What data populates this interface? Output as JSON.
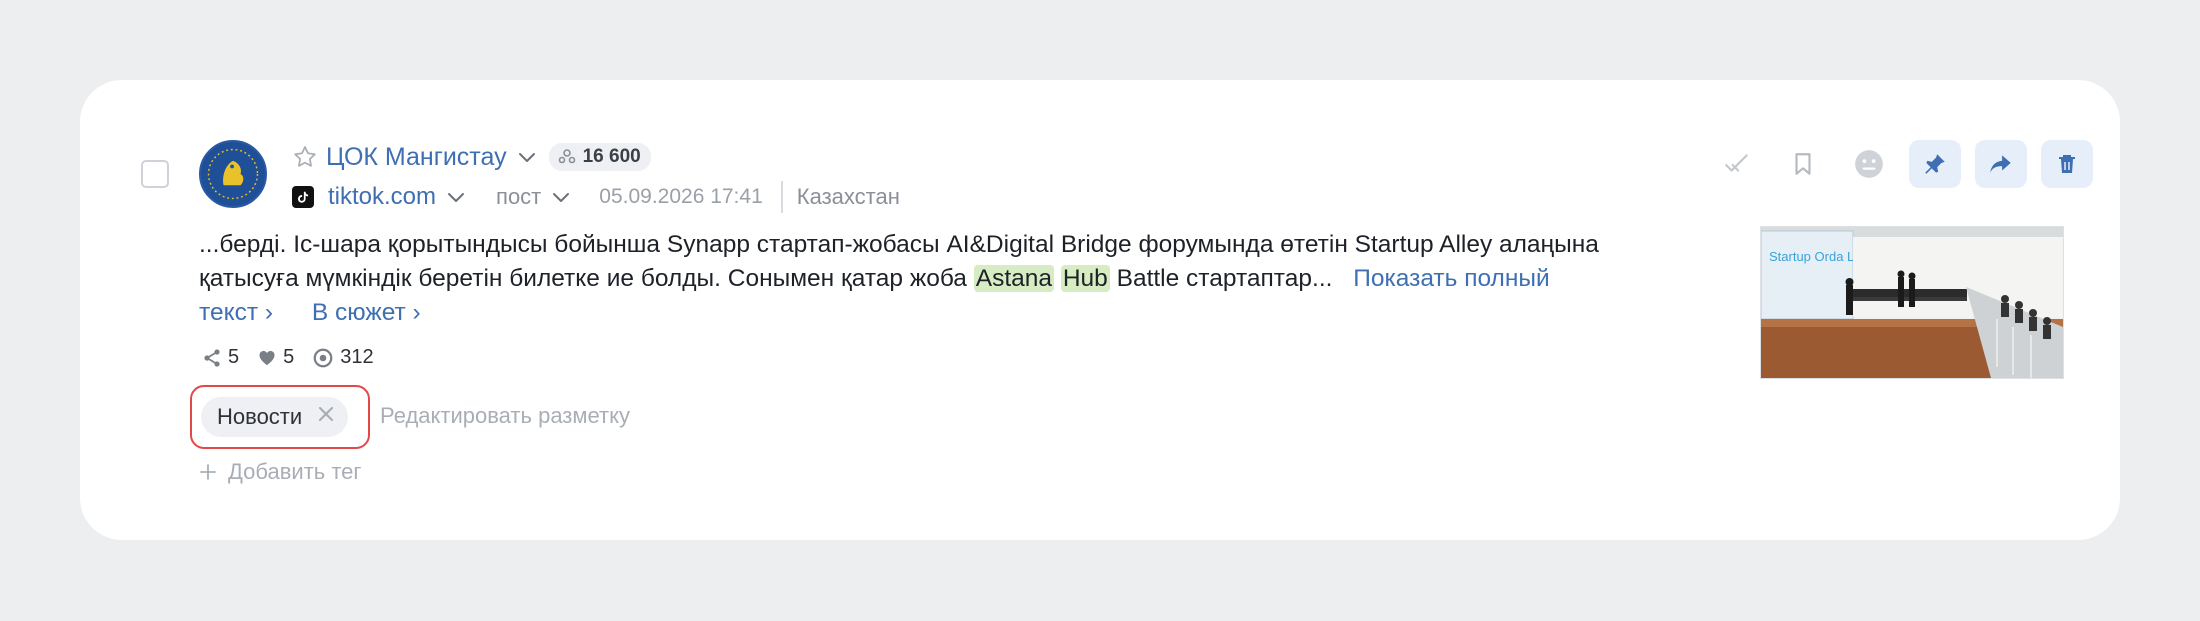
{
  "post": {
    "source_name": "ЦОК Мангистау",
    "audience_count": "16 600",
    "domain": "tiktok.com",
    "type": "пост",
    "datetime": "05.09.2026 17:41",
    "country": "Казахстан",
    "text_parts": {
      "p1": "...берді. Іс-шара қорытындысы бойынша Synapp стартап-жобасы AI&Digital Bridge форумында өтетін Startup Alley алаңына қатысуға мүмкіндік беретін билетке ие болды. Сонымен қатар жоба ",
      "hl1": "Astana",
      "hl2": "Hub",
      "p2": " Battle стартаптар..."
    },
    "show_full_text": "Показать полный текст",
    "to_story": "В сюжет",
    "stats": {
      "reposts": "5",
      "likes": "5",
      "views": "312"
    },
    "tags": [
      "Новости"
    ],
    "edit_markup": "Редактировать разметку",
    "add_tag": "Добавить тег",
    "thumbnail_caption": "Startup Orda Lab"
  },
  "colors": {
    "link": "#3f6fb2",
    "highlight": "#d6ecc2",
    "accent_button_bg": "#e6eef9",
    "tag_outline": "#e24848"
  },
  "icons": [
    "star-icon",
    "chevron-down-icon",
    "audience-icon",
    "tiktok-icon",
    "share-icon",
    "heart-icon",
    "eye-icon",
    "close-icon",
    "plus-icon",
    "check-icon",
    "bookmark-icon",
    "sentiment-neutral-icon",
    "pin-icon",
    "forward-icon",
    "trash-icon"
  ]
}
